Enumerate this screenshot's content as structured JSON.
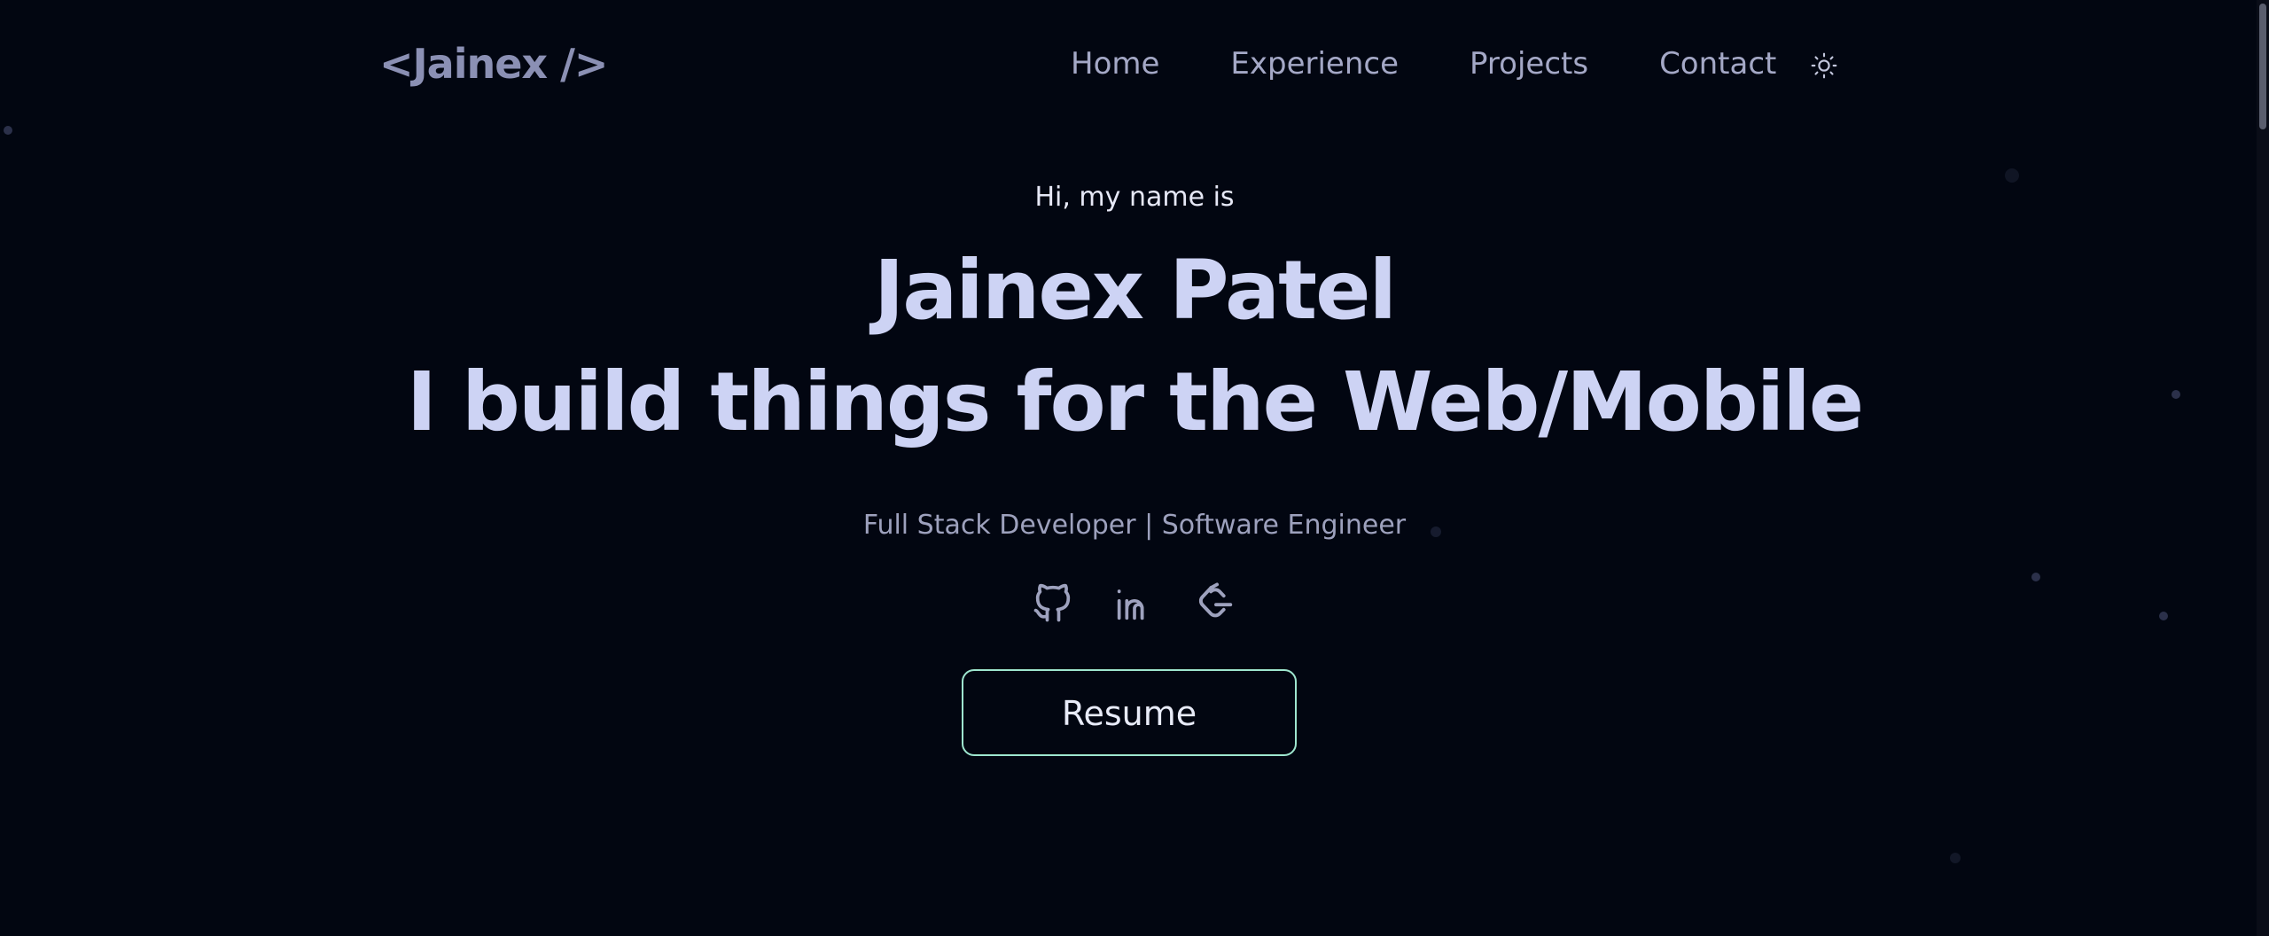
{
  "navbar": {
    "logo": "<Jainex />",
    "links": [
      {
        "label": "Home"
      },
      {
        "label": "Experience"
      },
      {
        "label": "Projects"
      },
      {
        "label": "Contact"
      }
    ],
    "theme_toggle_icon": "sun-icon"
  },
  "hero": {
    "greeting": "Hi, my name is",
    "name": "Jainex Patel",
    "tagline": "I build things for the Web/Mobile",
    "role": "Full Stack Developer | Software Engineer",
    "socials": [
      {
        "icon": "github-icon"
      },
      {
        "icon": "linkedin-icon"
      },
      {
        "icon": "leetcode-icon"
      }
    ],
    "resume_label": "Resume"
  },
  "colors": {
    "background": "#020611",
    "heading": "#cdd3f4",
    "nav_text": "#a4a8c6",
    "logo": "#8b90b4",
    "button_border": "#9ee6cf"
  }
}
